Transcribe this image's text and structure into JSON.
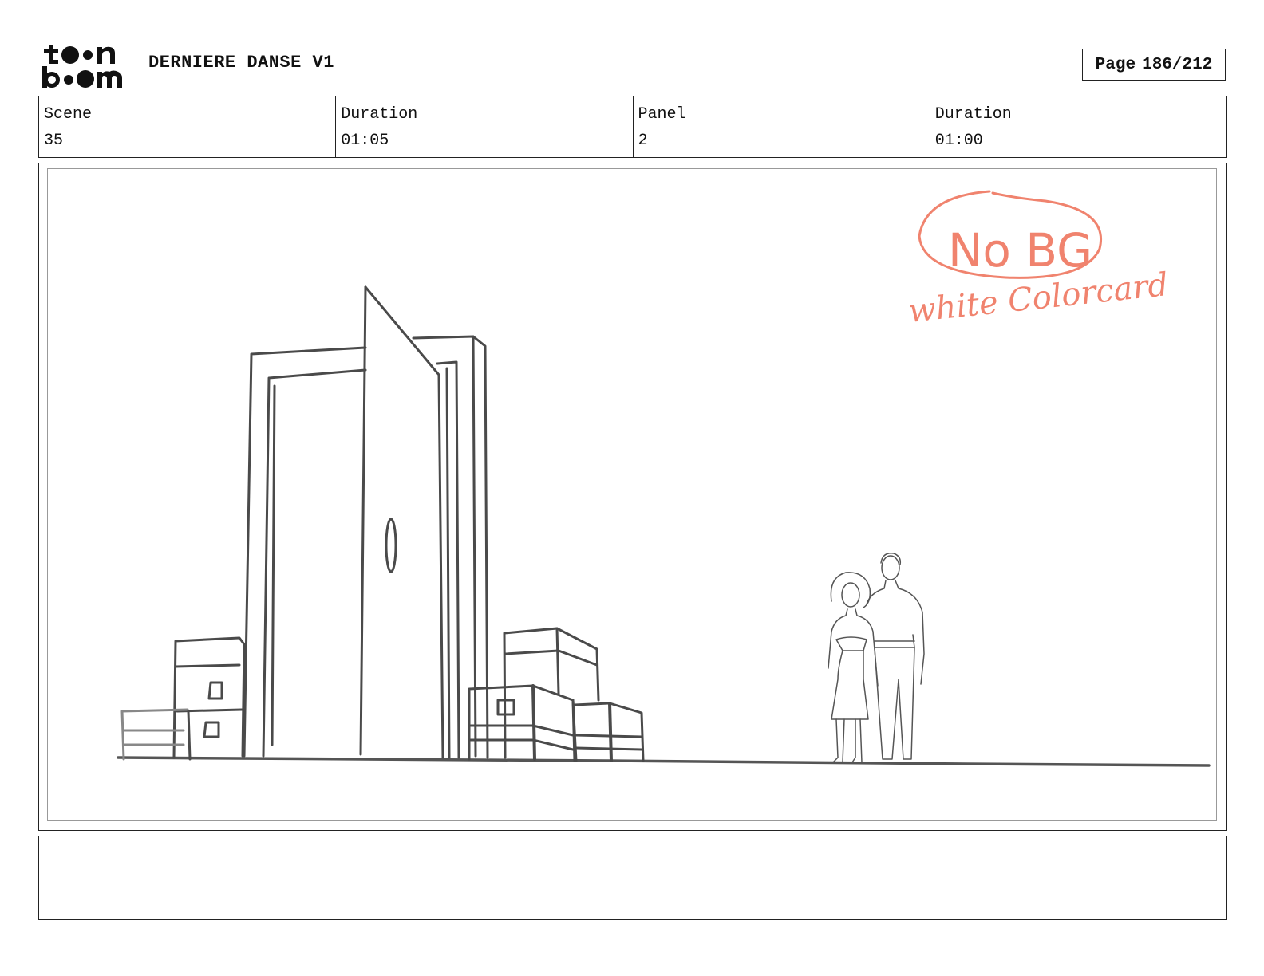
{
  "header": {
    "logo_text": "toon boom",
    "project_title": "DERNIERE DANSE V1",
    "page_label": "Page",
    "page_value": "186/212"
  },
  "info": [
    {
      "label": "Scene",
      "value": "35"
    },
    {
      "label": "Duration",
      "value": "01:05"
    },
    {
      "label": "Panel",
      "value": "2"
    },
    {
      "label": "Duration",
      "value": "01:00"
    }
  ],
  "panel": {
    "annotation_circled": "No BG",
    "annotation_note": "white Colorcard",
    "annotation_color": "#f0836e",
    "sketch_color": "#3a3a3a"
  },
  "notes": {
    "text": ""
  }
}
